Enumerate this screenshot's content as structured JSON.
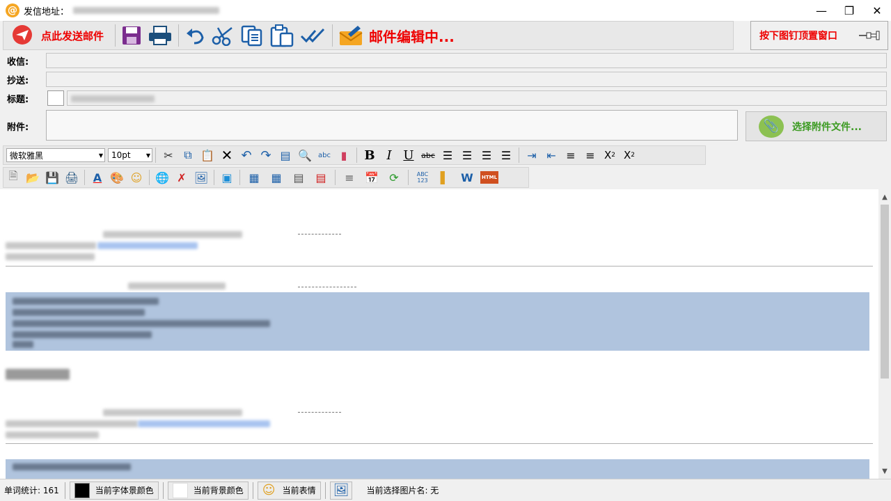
{
  "window": {
    "title": "发信地址："
  },
  "toolbar": {
    "send_label": "点此发送邮件",
    "status_label": "邮件编辑中...",
    "pin_label": "按下图钉顶置窗口"
  },
  "fields": {
    "to_label": "收信:",
    "cc_label": "抄送:",
    "subject_label": "标题:",
    "attach_label": "附件:",
    "attach_button": "选择附件文件..."
  },
  "format": {
    "font_family": "微软雅黑",
    "font_size": "10pt"
  },
  "statusbar": {
    "word_count": "单词统计: 161",
    "font_color_label": "当前字体景颜色",
    "bg_color_label": "当前背景颜色",
    "emoji_label": "当前表情",
    "selected_image_label": "当前选择图片名: 无"
  },
  "colors": {
    "accent_red": "#ee0000",
    "attach_green": "#3a9a20",
    "highlight_blue": "#b0c4de",
    "font_color": "#000000",
    "bg_color": "#ffffff"
  }
}
